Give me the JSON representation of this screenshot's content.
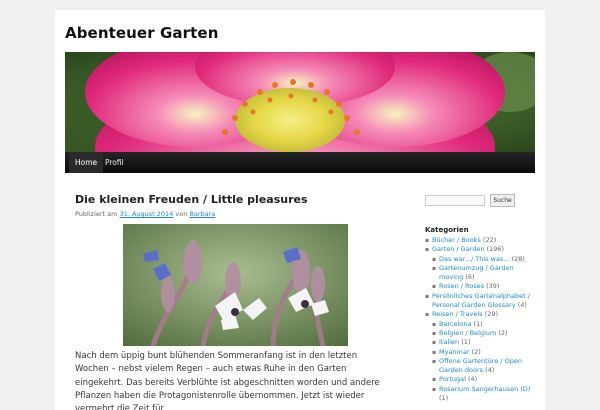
{
  "site": {
    "title": "Abenteuer Garten"
  },
  "nav": {
    "items": [
      {
        "label": "Home"
      },
      {
        "label": "Profil"
      }
    ]
  },
  "post": {
    "title": "Die kleinen Freuden / Little pleasures",
    "meta_prefix": "Publiziert am",
    "date": "31. August 2014",
    "meta_by": "von",
    "author": "Barbara",
    "body": "Nach dem üppig bunt blühenden Sommeranfang ist in den letzten Wochen – nebst vielem Regen – auch etwas Ruhe in den Garten eingekehrt. Das bereits Verblühte ist abgeschnitten worden und andere Pflanzen haben die Protagonistenrolle übernommen. Jetzt ist wieder vermehrt die Zeit für"
  },
  "sidebar": {
    "search_button": "Suche",
    "categories_title": "Kategorien",
    "categories": [
      {
        "label": "Bücher / Books",
        "count": "(22)",
        "child": false
      },
      {
        "label": "Garten / Garden",
        "count": "(196)",
        "child": false
      },
      {
        "label": "Das war.../ This was...",
        "count": "(28)",
        "child": true
      },
      {
        "label": "Gartenumzug / Garden moving",
        "count": "(6)",
        "child": true
      },
      {
        "label": "Rosen / Roses",
        "count": "(39)",
        "child": true
      },
      {
        "label": "Persönliches Gartenalphabet / Personal Garden Glossary",
        "count": "(4)",
        "child": false
      },
      {
        "label": "Reisen / Travels",
        "count": "(29)",
        "child": false
      },
      {
        "label": "Barcelona",
        "count": "(1)",
        "child": true
      },
      {
        "label": "Belgien / Belgium",
        "count": "(2)",
        "child": true
      },
      {
        "label": "Italien",
        "count": "(1)",
        "child": true
      },
      {
        "label": "Myanmar",
        "count": "(2)",
        "child": true
      },
      {
        "label": "Offene Gartentüre / Open Garden doors",
        "count": "(4)",
        "child": true
      },
      {
        "label": "Portugal",
        "count": "(4)",
        "child": true
      },
      {
        "label": "Rosarium Sangerhausen (D)",
        "count": "(1)",
        "child": true
      }
    ]
  },
  "colors": {
    "link": "#1b8be0",
    "nav_bg": "#111111",
    "page_bg": "#f1f1f1"
  }
}
